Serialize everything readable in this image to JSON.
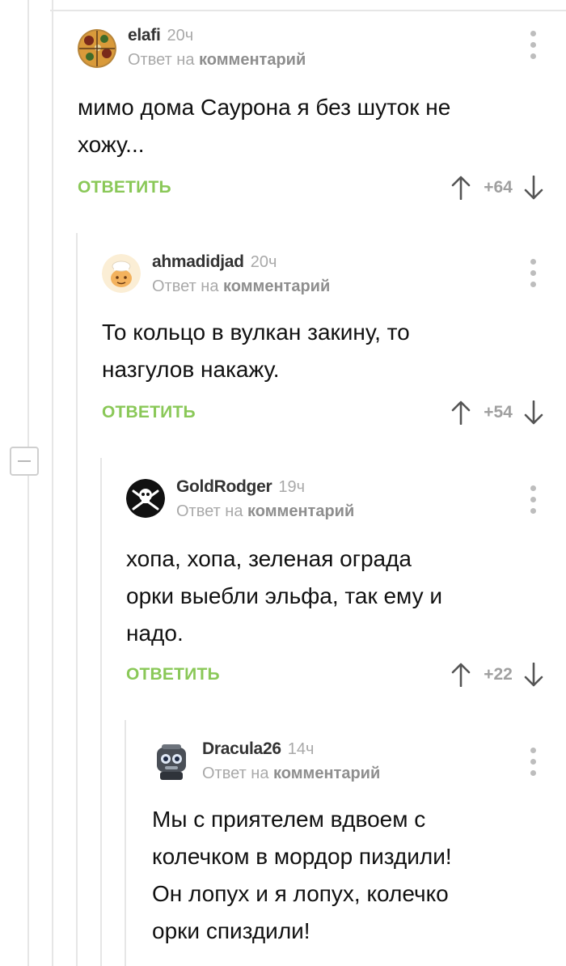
{
  "comments": [
    {
      "author": "elafi",
      "time": "20ч",
      "reply_prefix": "Ответ на",
      "reply_target": "комментарий",
      "lines": [
        "мимо дома Саурона я без шуток не",
        "хожу..."
      ],
      "reply_label": "ОТВЕТИТЬ",
      "score": "+64",
      "avatar_icon": "pizza-avatar-icon"
    },
    {
      "author": "ahmadidjad",
      "time": "20ч",
      "reply_prefix": "Ответ на",
      "reply_target": "комментарий",
      "lines": [
        "То кольцо в вулкан закину, то",
        "назгулов накажу."
      ],
      "reply_label": "ОТВЕТИТЬ",
      "score": "+54",
      "avatar_icon": "chef-avatar-icon"
    },
    {
      "author": "GoldRodger",
      "time": "19ч",
      "reply_prefix": "Ответ на",
      "reply_target": "комментарий",
      "lines": [
        "хопа, хопа, зеленая ограда",
        "орки выебли эльфа, так ему и",
        "надо."
      ],
      "reply_label": "ОТВЕТИТЬ",
      "score": "+22",
      "avatar_icon": "jolly-roger-avatar-icon"
    },
    {
      "author": "Dracula26",
      "time": "14ч",
      "reply_prefix": "Ответ на",
      "reply_target": "комментарий",
      "lines": [
        "Мы с приятелем вдвоем с",
        "колечком в мордор пиздили!",
        "Он лопух и я лопух, колечко",
        "орки спиздили!"
      ],
      "reply_label": "",
      "score": "",
      "avatar_icon": "robot-avatar-icon"
    }
  ],
  "colors": {
    "reply_green": "#8ac858",
    "muted_gray": "#a9a9a9",
    "thread_line": "#e6e6e6"
  }
}
